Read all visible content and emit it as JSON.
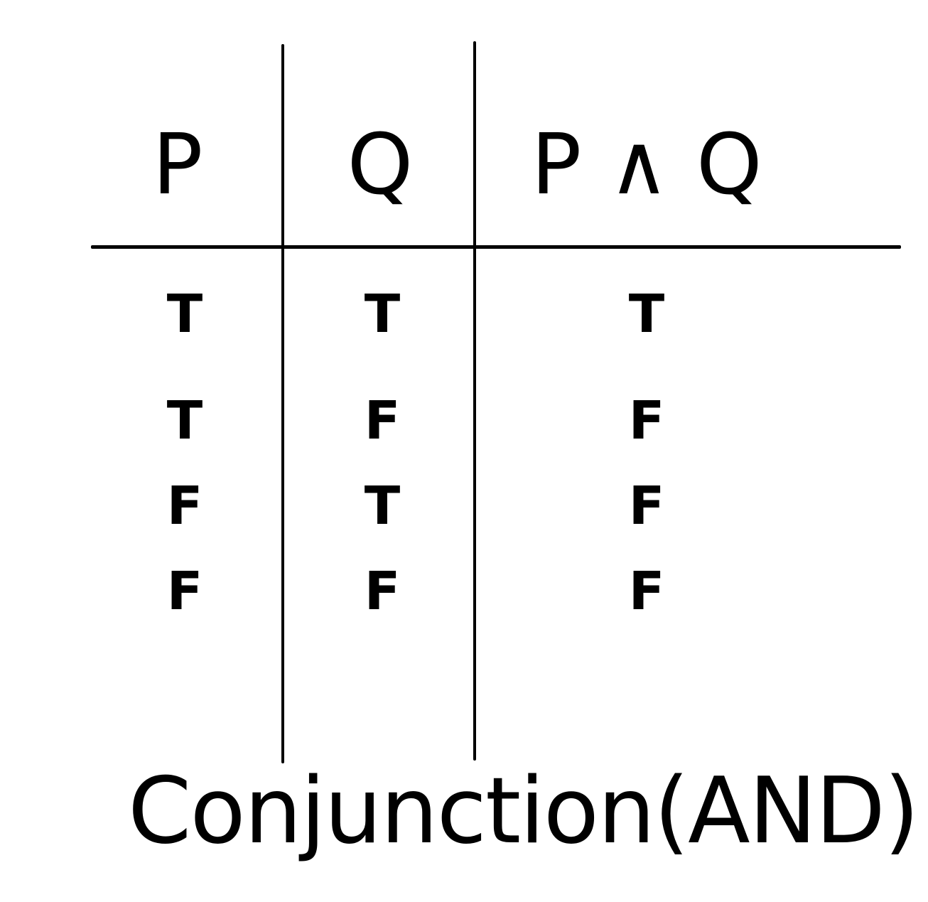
{
  "headers": {
    "p": "P",
    "q": "Q",
    "p_and_q": "P ∧ Q"
  },
  "rows": [
    {
      "p": "T",
      "q": "T",
      "p_and_q": "T"
    },
    {
      "p": "T",
      "q": "F",
      "p_and_q": "F"
    },
    {
      "p": "F",
      "q": "T",
      "p_and_q": "F"
    },
    {
      "p": "F",
      "q": "F",
      "p_and_q": "F"
    }
  ],
  "caption": "Conjunction(AND)",
  "colors": {
    "ink": "#000000",
    "paper": "#ffffff"
  }
}
